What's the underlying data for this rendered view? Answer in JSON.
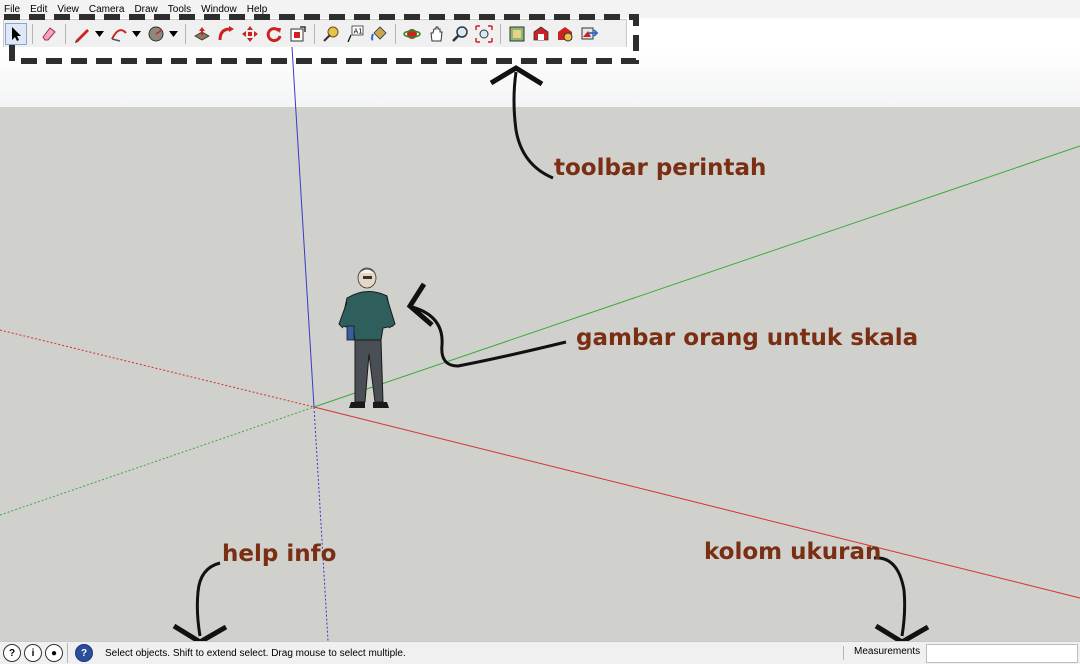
{
  "menu": [
    "File",
    "Edit",
    "View",
    "Camera",
    "Draw",
    "Tools",
    "Window",
    "Help"
  ],
  "toolbar_icons": [
    "select-icon",
    "eraser-icon",
    "pencil-line-icon",
    "arc-icon",
    "shape-circle-icon",
    "push-pull-icon",
    "follow-me-icon",
    "move-icon",
    "rotate-icon",
    "scale-icon",
    "tape-measure-icon",
    "text-icon",
    "paint-bucket-icon",
    "orbit-icon",
    "pan-icon",
    "zoom-icon",
    "zoom-extents-icon",
    "components-icon",
    "warehouse-icon",
    "share-model-icon",
    "preview-icon"
  ],
  "annotations": {
    "toolbar": "toolbar perintah",
    "person": "gambar orang untuk skala",
    "help": "help info",
    "measure": "kolom ukuran"
  },
  "status": {
    "text": "Select objects. Shift to extend select. Drag mouse to select multiple.",
    "measurements_label": "Measurements",
    "measurements_value": ""
  },
  "colors": {
    "annotation": "#7a2e14",
    "axis_red": "#d43030",
    "axis_green": "#3caa3c",
    "axis_blue": "#3a3ac8",
    "ground": "#d0d0cc"
  }
}
